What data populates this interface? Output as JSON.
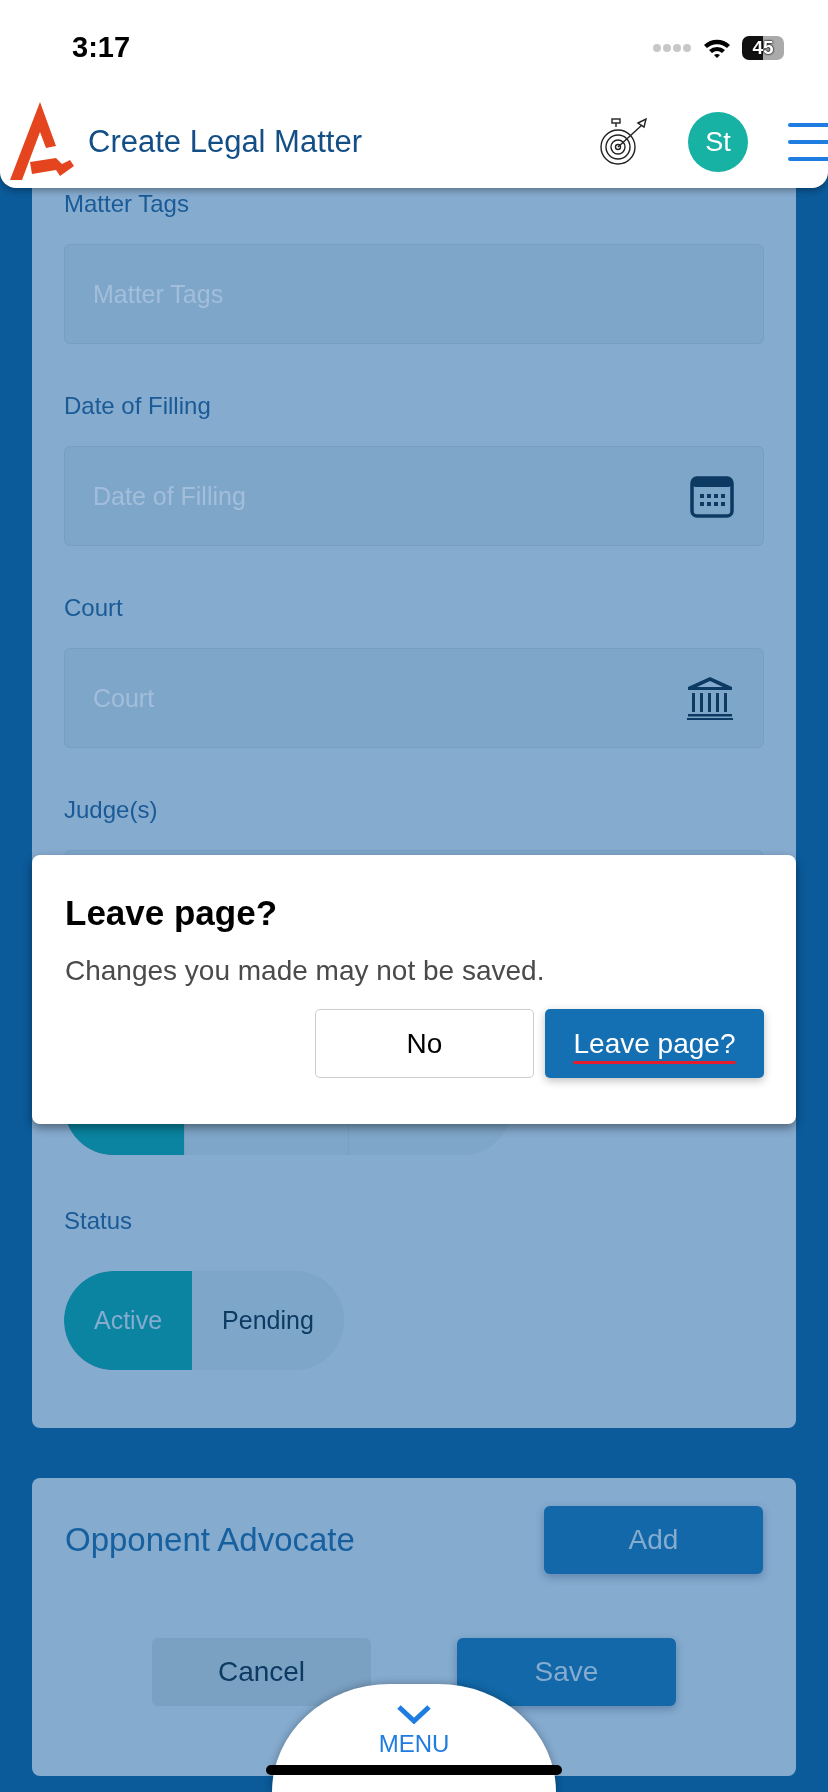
{
  "status_bar": {
    "time": "3:17",
    "battery": "45"
  },
  "header": {
    "title": "Create Legal Matter",
    "avatar": "St"
  },
  "form": {
    "fields": [
      {
        "label": "Matter Tags",
        "placeholder": "Matter Tags",
        "kind": "text"
      },
      {
        "label": "Date of Filling",
        "placeholder": "Date of Filling",
        "kind": "date"
      },
      {
        "label": "Court",
        "placeholder": "Court",
        "kind": "court"
      },
      {
        "label": "Judge(s)",
        "kind": "text"
      }
    ],
    "covered_toggle": {
      "segments": [
        {
          "selected": true
        },
        {
          "selected": false
        },
        {
          "selected": false
        }
      ]
    },
    "status": {
      "label": "Status",
      "options": [
        {
          "label": "Active",
          "selected": true
        },
        {
          "label": "Pending",
          "selected": false
        }
      ]
    }
  },
  "opponent_advocate": {
    "title": "Opponent Advocate",
    "add_button": "Add"
  },
  "actions": [
    {
      "label": "Cancel",
      "kind": "secondary"
    },
    {
      "label": "Save",
      "kind": "primary"
    }
  ],
  "menu_tab": {
    "label": "MENU"
  },
  "dialog": {
    "title": "Leave page?",
    "message": "Changes you made may not be saved.",
    "buttons": [
      {
        "label": "No",
        "kind": "secondary",
        "focused": false
      },
      {
        "label": "Leave page?",
        "kind": "primary",
        "focused": true
      }
    ]
  }
}
